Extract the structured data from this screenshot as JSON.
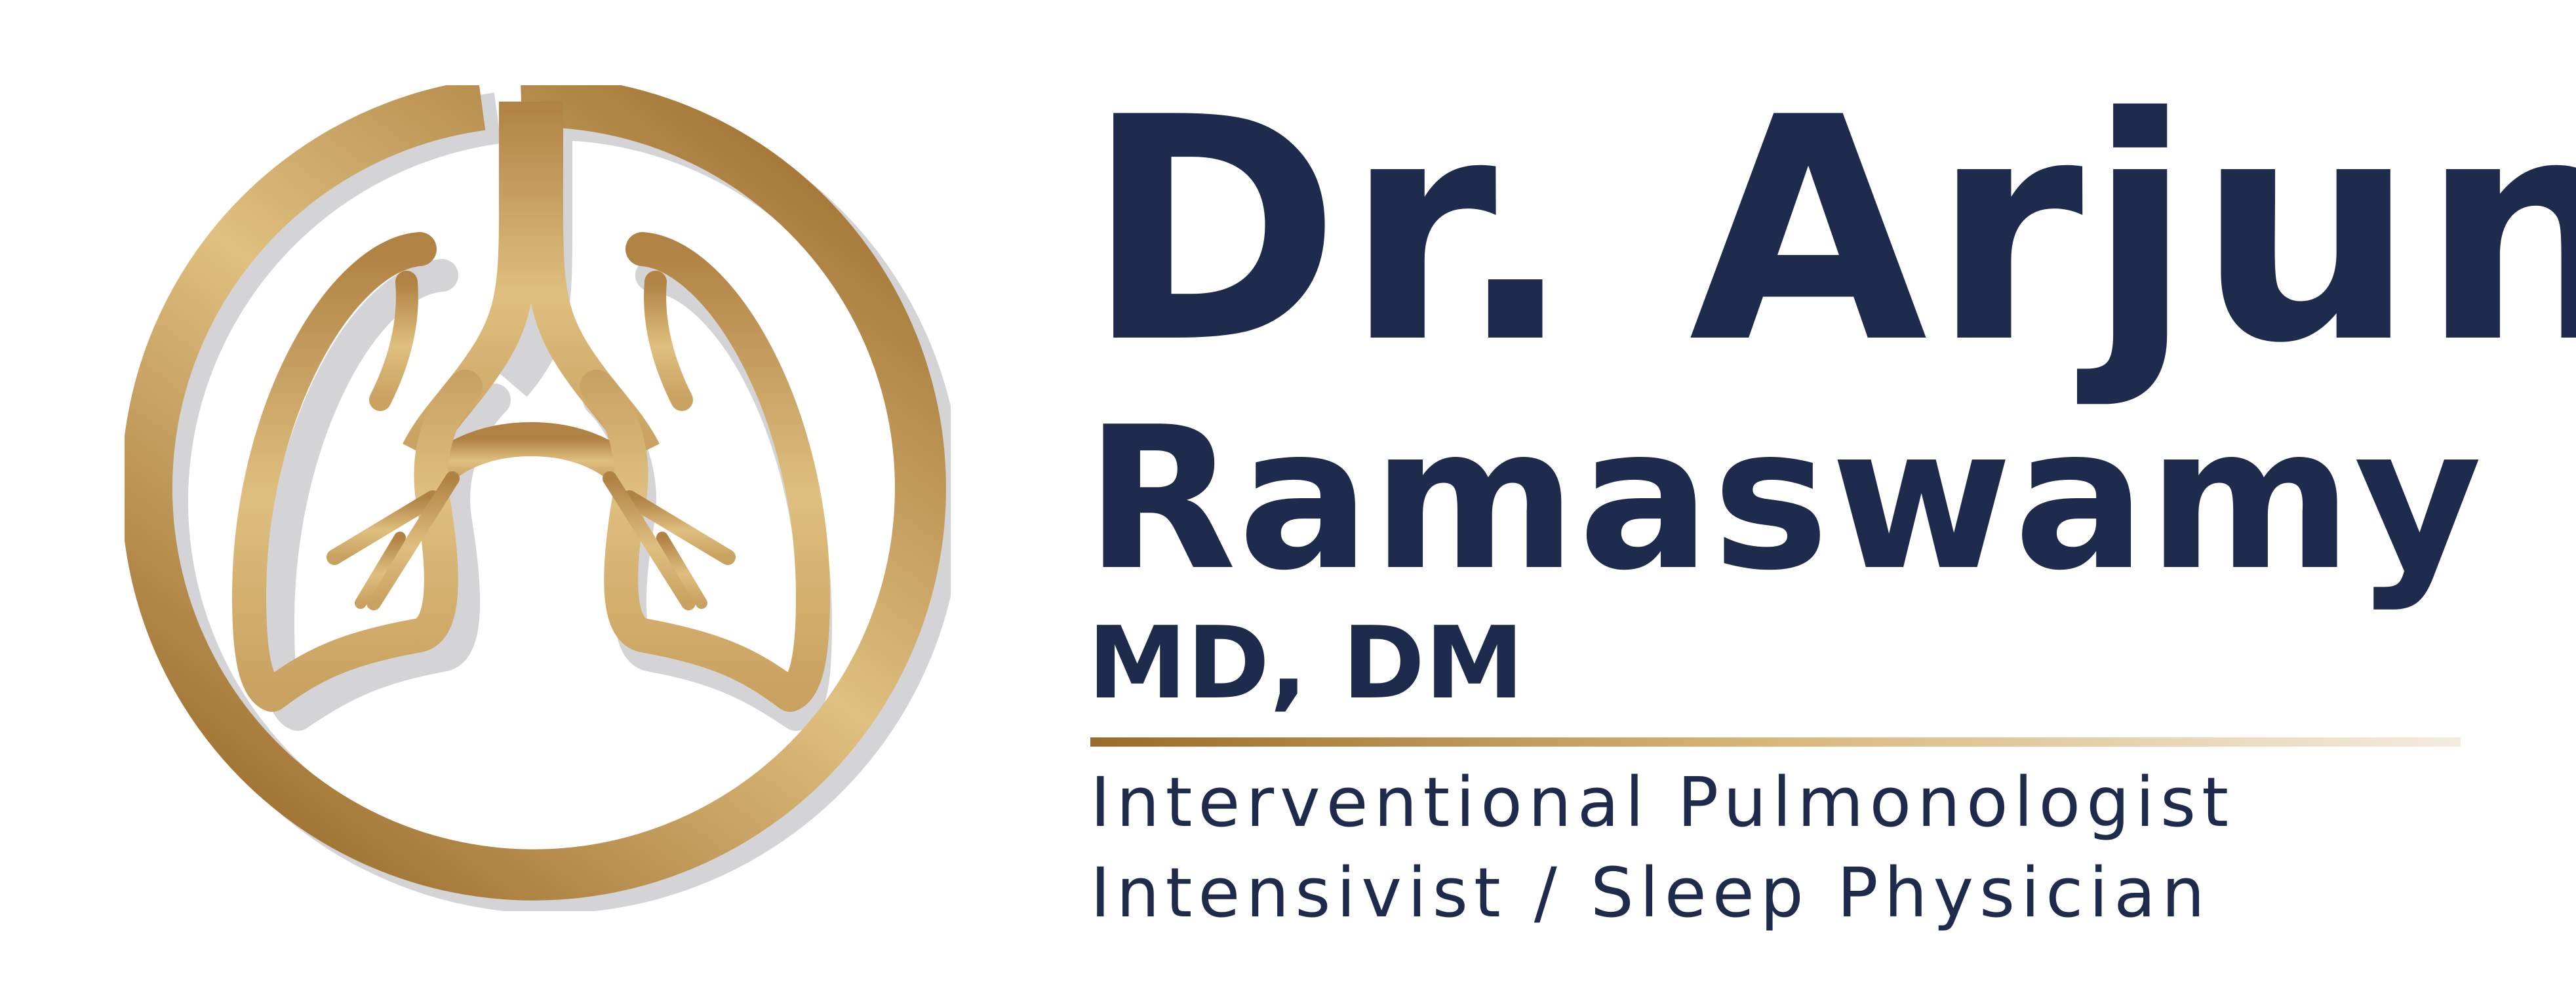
{
  "brand": {
    "name_first": "Dr. Arjun",
    "name_last": "Ramaswamy",
    "credentials": "MD, DM",
    "specialties": [
      "Interventional Pulmonologist",
      "Intensivist / Sleep Physician"
    ]
  },
  "logo": {
    "icon": "lungs-in-ring-icon"
  },
  "colors": {
    "navy": "#1f2b4d",
    "gold_dark": "#9a6b2b",
    "gold_light": "#e0c080",
    "shadow": "#d4d4d6",
    "background": "#ffffff"
  }
}
